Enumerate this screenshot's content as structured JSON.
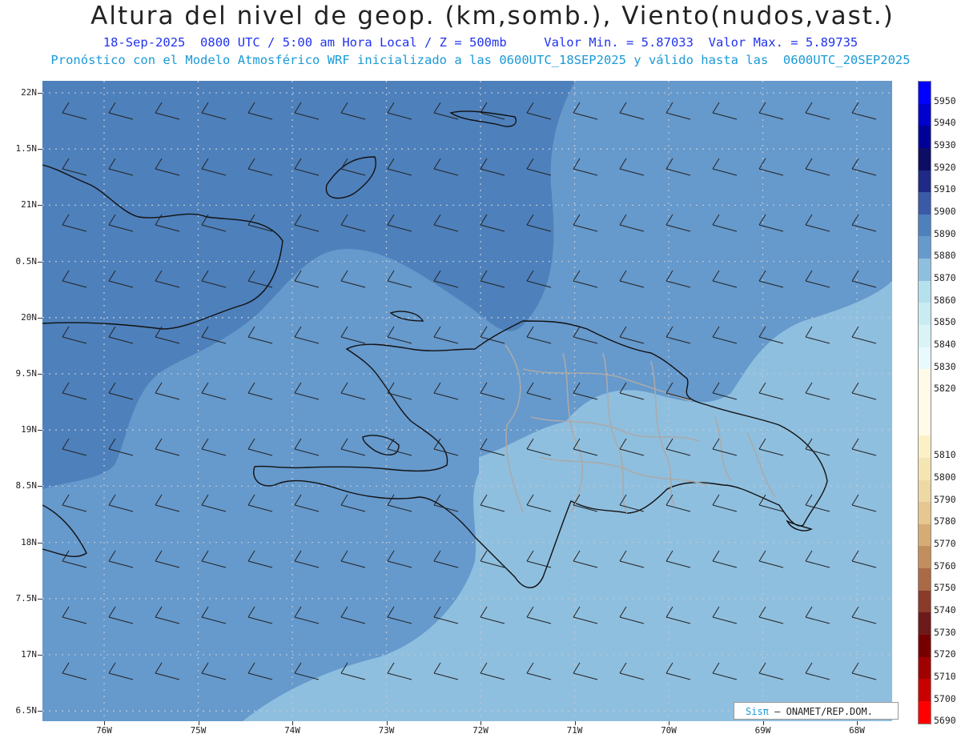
{
  "header": {
    "title": "Altura del nivel de geop. (km,somb.), Viento(nudos,vast.)",
    "line1": "18-Sep-2025  0800 UTC / 5:00 am Hora Local / Z = 500mb     Valor Min. = 5.87033  Valor Max. = 5.89735",
    "line2": "Pronóstico con el Modelo Atmosférico WRF inicializado a las 0600UTC_18SEP2025 y válido hasta las  0600UTC_20SEP2025"
  },
  "lat_labels": [
    "22N",
    "1.5N",
    "21N",
    "0.5N",
    "20N",
    "9.5N",
    "19N",
    "8.5N",
    "18N",
    "7.5N",
    "17N",
    "6.5N"
  ],
  "lon_labels": [
    "76W",
    "75W",
    "74W",
    "73W",
    "72W",
    "71W",
    "70W",
    "69W",
    "68W"
  ],
  "colorbar": {
    "levels": [
      "5950",
      "5940",
      "5930",
      "5920",
      "5910",
      "5900",
      "5890",
      "5880",
      "5870",
      "5860",
      "5850",
      "5840",
      "5830",
      "5820",
      "5810",
      "5800",
      "5790",
      "5780",
      "5770",
      "5760",
      "5750",
      "5740",
      "5730",
      "5720",
      "5710",
      "5700",
      "5690"
    ],
    "colors": [
      "#0000ff",
      "#0000cc",
      "#000099",
      "#0d0d66",
      "#1e2a85",
      "#3a5aa8",
      "#4e80bb",
      "#6699cc",
      "#8fbfdf",
      "#b5e0ee",
      "#c9ecf3",
      "#d9f3f7",
      "#e9fafc",
      "#fffbe8",
      "#fbf0c6",
      "#f5e5b3",
      "#efd9a3",
      "#e6c790",
      "#d6ab74",
      "#c38e5d",
      "#a96a45",
      "#8a3b2a",
      "#6e1a1a",
      "#760000",
      "#a10000",
      "#c80000",
      "#ff0000"
    ]
  },
  "fill_colors": {
    "level_5890": "#4e80bb",
    "level_5880": "#6699cc",
    "level_5870": "#8fbfdf"
  },
  "credit": {
    "sis": "Sisπ",
    "text": "– ONAMET/REP.DOM."
  }
}
